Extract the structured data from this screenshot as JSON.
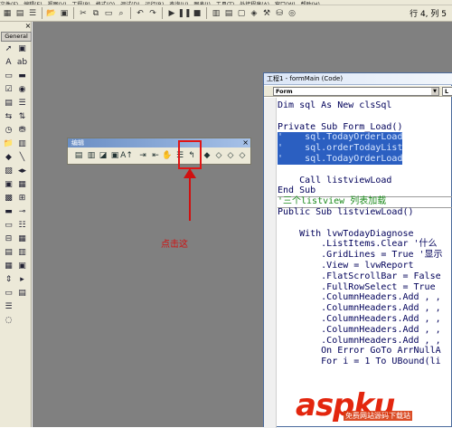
{
  "menubar": {
    "items": [
      "文件(F)",
      "编辑(E)",
      "视图(V)",
      "工程(P)",
      "格式(O)",
      "调试(D)",
      "运行(R)",
      "查询(U)",
      "图表(I)",
      "工具(T)",
      "外接程序(A)",
      "窗口(W)",
      "帮助(H)"
    ]
  },
  "toolbar": {
    "status_text": "行 4, 列 5"
  },
  "toolbox": {
    "general_label": "General",
    "close_glyph": "×"
  },
  "edit_toolbar": {
    "title": "编辑",
    "close_glyph": "×"
  },
  "annotation": {
    "callout": "点击这",
    "color": "#d01010"
  },
  "code_window": {
    "title": "工程1 - formMain (Code)",
    "object_combo": "Form",
    "proc_combo": "L",
    "lines": [
      {
        "text": "Dim sql As New clsSql",
        "kind": "code"
      },
      {
        "text": "",
        "kind": "code"
      },
      {
        "text": "Private Sub Form_Load()",
        "kind": "code"
      },
      {
        "text": "'    sql.TodayOrderLoad",
        "kind": "sel"
      },
      {
        "text": "'    sql.orderTodayList",
        "kind": "sel"
      },
      {
        "text": "'    sql.TodayOrderLoad",
        "kind": "sel"
      },
      {
        "text": "",
        "kind": "code"
      },
      {
        "text": "    Call listviewLoad",
        "kind": "code"
      },
      {
        "text": "End Sub",
        "kind": "code"
      },
      {
        "text": "'三个listview 列表加载",
        "kind": "comment"
      },
      {
        "text": "Public Sub listviewLoad()",
        "kind": "code"
      },
      {
        "text": "",
        "kind": "code"
      },
      {
        "text": "    With lvwTodayDiagnose",
        "kind": "code"
      },
      {
        "text": "        .ListItems.Clear '什么",
        "kind": "code"
      },
      {
        "text": "        .GridLines = True '显示",
        "kind": "code"
      },
      {
        "text": "        .View = lvwReport",
        "kind": "code"
      },
      {
        "text": "        .FlatScrollBar = False",
        "kind": "code"
      },
      {
        "text": "        .FullRowSelect = True",
        "kind": "code"
      },
      {
        "text": "        .ColumnHeaders.Add , ,",
        "kind": "code"
      },
      {
        "text": "        .ColumnHeaders.Add , ,",
        "kind": "code"
      },
      {
        "text": "        .ColumnHeaders.Add , ,",
        "kind": "code"
      },
      {
        "text": "        .ColumnHeaders.Add , ,",
        "kind": "code"
      },
      {
        "text": "        .ColumnHeaders.Add , ,",
        "kind": "code"
      },
      {
        "text": "        On Error GoTo ArrNullA",
        "kind": "code"
      },
      {
        "text": "        For i = 1 To UBound(li",
        "kind": "code"
      }
    ]
  },
  "watermark": {
    "brand": "aspku",
    "domain_suffix": ".net",
    "tagline": "免费网站源码下载站"
  }
}
